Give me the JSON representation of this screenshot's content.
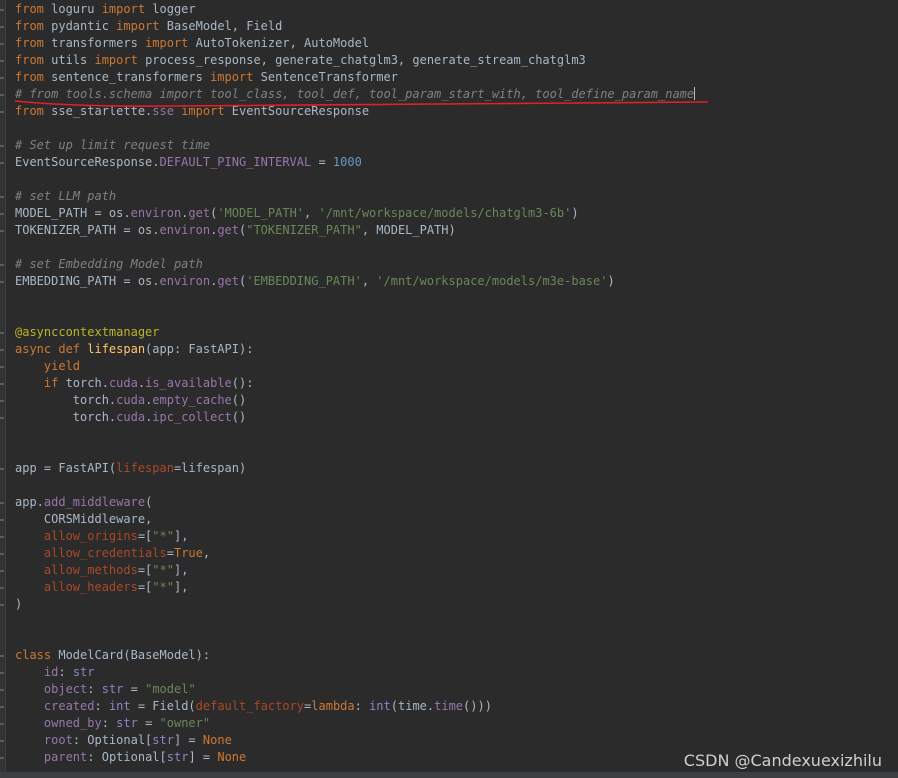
{
  "editor": {
    "lines": [
      [
        {
          "c": "kw",
          "t": "from"
        },
        {
          "c": "op",
          "t": " loguru "
        },
        {
          "c": "kw",
          "t": "import"
        },
        {
          "c": "op",
          "t": " logger"
        }
      ],
      [
        {
          "c": "kw",
          "t": "from"
        },
        {
          "c": "op",
          "t": " pydantic "
        },
        {
          "c": "kw",
          "t": "import"
        },
        {
          "c": "op",
          "t": " BaseModel, Field"
        }
      ],
      [
        {
          "c": "kw",
          "t": "from"
        },
        {
          "c": "op",
          "t": " transformers "
        },
        {
          "c": "kw",
          "t": "import"
        },
        {
          "c": "op",
          "t": " AutoTokenizer, AutoModel"
        }
      ],
      [
        {
          "c": "kw",
          "t": "from"
        },
        {
          "c": "op",
          "t": " utils "
        },
        {
          "c": "kw",
          "t": "import"
        },
        {
          "c": "op",
          "t": " process_response, generate_chatglm3, generate_stream_chatglm3"
        }
      ],
      [
        {
          "c": "kw",
          "t": "from"
        },
        {
          "c": "op",
          "t": " sentence_transformers "
        },
        {
          "c": "kw",
          "t": "import"
        },
        {
          "c": "op",
          "t": " SentenceTransformer"
        }
      ],
      [
        {
          "c": "hl-comment",
          "t": "# from tools.schema import tool_class, tool_def, tool_param_start_with, tool_define_param_name"
        }
      ],
      [
        {
          "c": "kw",
          "t": "from"
        },
        {
          "c": "op",
          "t": " sse_starlette."
        },
        {
          "c": "attr",
          "t": "sse"
        },
        {
          "c": "op",
          "t": " "
        },
        {
          "c": "kw",
          "t": "import"
        },
        {
          "c": "op",
          "t": " EventSourceResponse"
        }
      ],
      [
        {
          "c": "op",
          "t": ""
        }
      ],
      [
        {
          "c": "hl-comment",
          "t": "# Set up limit request time"
        }
      ],
      [
        {
          "c": "op",
          "t": "EventSourceResponse."
        },
        {
          "c": "attr",
          "t": "DEFAULT_PING_INTERVAL"
        },
        {
          "c": "op",
          "t": " = "
        },
        {
          "c": "num",
          "t": "1000"
        }
      ],
      [
        {
          "c": "op",
          "t": ""
        }
      ],
      [
        {
          "c": "hl-comment",
          "t": "# set LLM path"
        }
      ],
      [
        {
          "c": "op",
          "t": "MODEL_PATH = os."
        },
        {
          "c": "attr",
          "t": "environ"
        },
        {
          "c": "op",
          "t": "."
        },
        {
          "c": "attr",
          "t": "get"
        },
        {
          "c": "op",
          "t": "("
        },
        {
          "c": "str",
          "t": "'MODEL_PATH'"
        },
        {
          "c": "op",
          "t": ", "
        },
        {
          "c": "str",
          "t": "'/mnt/workspace/models/chatglm3-6b'"
        },
        {
          "c": "op",
          "t": ")"
        }
      ],
      [
        {
          "c": "op",
          "t": "TOKENIZER_PATH = os."
        },
        {
          "c": "attr",
          "t": "environ"
        },
        {
          "c": "op",
          "t": "."
        },
        {
          "c": "attr",
          "t": "get"
        },
        {
          "c": "op",
          "t": "("
        },
        {
          "c": "str",
          "t": "\"TOKENIZER_PATH\""
        },
        {
          "c": "op",
          "t": ", MODEL_PATH)"
        }
      ],
      [
        {
          "c": "op",
          "t": ""
        }
      ],
      [
        {
          "c": "hl-comment",
          "t": "# set Embedding Model path"
        }
      ],
      [
        {
          "c": "op",
          "t": "EMBEDDING_PATH = os."
        },
        {
          "c": "attr",
          "t": "environ"
        },
        {
          "c": "op",
          "t": "."
        },
        {
          "c": "attr",
          "t": "get"
        },
        {
          "c": "op",
          "t": "("
        },
        {
          "c": "str",
          "t": "'EMBEDDING_PATH'"
        },
        {
          "c": "op",
          "t": ", "
        },
        {
          "c": "str",
          "t": "'/mnt/workspace/models/m3e-base'"
        },
        {
          "c": "op",
          "t": ")"
        }
      ],
      [
        {
          "c": "op",
          "t": ""
        }
      ],
      [
        {
          "c": "op",
          "t": ""
        }
      ],
      [
        {
          "c": "dec",
          "t": "@asynccontextmanager"
        }
      ],
      [
        {
          "c": "kw",
          "t": "async def "
        },
        {
          "c": "fn",
          "t": "lifespan"
        },
        {
          "c": "op",
          "t": "(app: FastAPI):"
        }
      ],
      [
        {
          "c": "op",
          "t": "    "
        },
        {
          "c": "kw",
          "t": "yield"
        }
      ],
      [
        {
          "c": "op",
          "t": "    "
        },
        {
          "c": "kw",
          "t": "if"
        },
        {
          "c": "op",
          "t": " torch."
        },
        {
          "c": "attr",
          "t": "cuda"
        },
        {
          "c": "op",
          "t": "."
        },
        {
          "c": "attr",
          "t": "is_available"
        },
        {
          "c": "op",
          "t": "():"
        }
      ],
      [
        {
          "c": "op",
          "t": "        torch."
        },
        {
          "c": "attr",
          "t": "cuda"
        },
        {
          "c": "op",
          "t": "."
        },
        {
          "c": "attr",
          "t": "empty_cache"
        },
        {
          "c": "op",
          "t": "()"
        }
      ],
      [
        {
          "c": "op",
          "t": "        torch."
        },
        {
          "c": "attr",
          "t": "cuda"
        },
        {
          "c": "op",
          "t": "."
        },
        {
          "c": "attr",
          "t": "ipc_collect"
        },
        {
          "c": "op",
          "t": "()"
        }
      ],
      [
        {
          "c": "op",
          "t": ""
        }
      ],
      [
        {
          "c": "op",
          "t": ""
        }
      ],
      [
        {
          "c": "op",
          "t": "app = FastAPI("
        },
        {
          "c": "param",
          "t": "lifespan"
        },
        {
          "c": "op",
          "t": "=lifespan)"
        }
      ],
      [
        {
          "c": "op",
          "t": ""
        }
      ],
      [
        {
          "c": "op",
          "t": "app."
        },
        {
          "c": "attr",
          "t": "add_middleware"
        },
        {
          "c": "op",
          "t": "("
        }
      ],
      [
        {
          "c": "op",
          "t": "    CORSMiddleware,"
        }
      ],
      [
        {
          "c": "op",
          "t": "    "
        },
        {
          "c": "param",
          "t": "allow_origins"
        },
        {
          "c": "op",
          "t": "=["
        },
        {
          "c": "str",
          "t": "\"*\""
        },
        {
          "c": "op",
          "t": "],"
        }
      ],
      [
        {
          "c": "op",
          "t": "    "
        },
        {
          "c": "param",
          "t": "allow_credentials"
        },
        {
          "c": "op",
          "t": "="
        },
        {
          "c": "kw",
          "t": "True"
        },
        {
          "c": "op",
          "t": ","
        }
      ],
      [
        {
          "c": "op",
          "t": "    "
        },
        {
          "c": "param",
          "t": "allow_methods"
        },
        {
          "c": "op",
          "t": "=["
        },
        {
          "c": "str",
          "t": "\"*\""
        },
        {
          "c": "op",
          "t": "],"
        }
      ],
      [
        {
          "c": "op",
          "t": "    "
        },
        {
          "c": "param",
          "t": "allow_headers"
        },
        {
          "c": "op",
          "t": "=["
        },
        {
          "c": "str",
          "t": "\"*\""
        },
        {
          "c": "op",
          "t": "],"
        }
      ],
      [
        {
          "c": "op",
          "t": ")"
        }
      ],
      [
        {
          "c": "op",
          "t": ""
        }
      ],
      [
        {
          "c": "op",
          "t": ""
        }
      ],
      [
        {
          "c": "kw",
          "t": "class "
        },
        {
          "c": "cls",
          "t": "ModelCard"
        },
        {
          "c": "op",
          "t": "(BaseModel):"
        }
      ],
      [
        {
          "c": "op",
          "t": "    "
        },
        {
          "c": "attr",
          "t": "id"
        },
        {
          "c": "op",
          "t": ": "
        },
        {
          "c": "builtin",
          "t": "str"
        }
      ],
      [
        {
          "c": "op",
          "t": "    "
        },
        {
          "c": "attr",
          "t": "object"
        },
        {
          "c": "op",
          "t": ": "
        },
        {
          "c": "builtin",
          "t": "str"
        },
        {
          "c": "op",
          "t": " = "
        },
        {
          "c": "str",
          "t": "\"model\""
        }
      ],
      [
        {
          "c": "op",
          "t": "    "
        },
        {
          "c": "attr",
          "t": "created"
        },
        {
          "c": "op",
          "t": ": "
        },
        {
          "c": "builtin",
          "t": "int"
        },
        {
          "c": "op",
          "t": " = Field("
        },
        {
          "c": "param",
          "t": "default_factory"
        },
        {
          "c": "op",
          "t": "="
        },
        {
          "c": "kw",
          "t": "lambda"
        },
        {
          "c": "op",
          "t": ": "
        },
        {
          "c": "builtin",
          "t": "int"
        },
        {
          "c": "op",
          "t": "(time."
        },
        {
          "c": "attr",
          "t": "time"
        },
        {
          "c": "op",
          "t": "()))"
        }
      ],
      [
        {
          "c": "op",
          "t": "    "
        },
        {
          "c": "attr",
          "t": "owned_by"
        },
        {
          "c": "op",
          "t": ": "
        },
        {
          "c": "builtin",
          "t": "str"
        },
        {
          "c": "op",
          "t": " = "
        },
        {
          "c": "str",
          "t": "\"owner\""
        }
      ],
      [
        {
          "c": "op",
          "t": "    "
        },
        {
          "c": "attr",
          "t": "root"
        },
        {
          "c": "op",
          "t": ": Optional["
        },
        {
          "c": "builtin",
          "t": "str"
        },
        {
          "c": "op",
          "t": "] = "
        },
        {
          "c": "kw",
          "t": "None"
        }
      ],
      [
        {
          "c": "op",
          "t": "    "
        },
        {
          "c": "attr",
          "t": "parent"
        },
        {
          "c": "op",
          "t": ": Optional["
        },
        {
          "c": "builtin",
          "t": "str"
        },
        {
          "c": "op",
          "t": "] = "
        },
        {
          "c": "kw",
          "t": "None"
        }
      ]
    ]
  },
  "watermark": "CSDN @Candexuexizhilu",
  "colors": {
    "background": "#2b2b2b",
    "keyword": "#cc7832",
    "string": "#6a8759",
    "number": "#6897bb",
    "function": "#ffc66d",
    "attribute": "#9876aa",
    "comment": "#808080",
    "decorator": "#bbb529",
    "annotation_underline": "#e0202a"
  }
}
